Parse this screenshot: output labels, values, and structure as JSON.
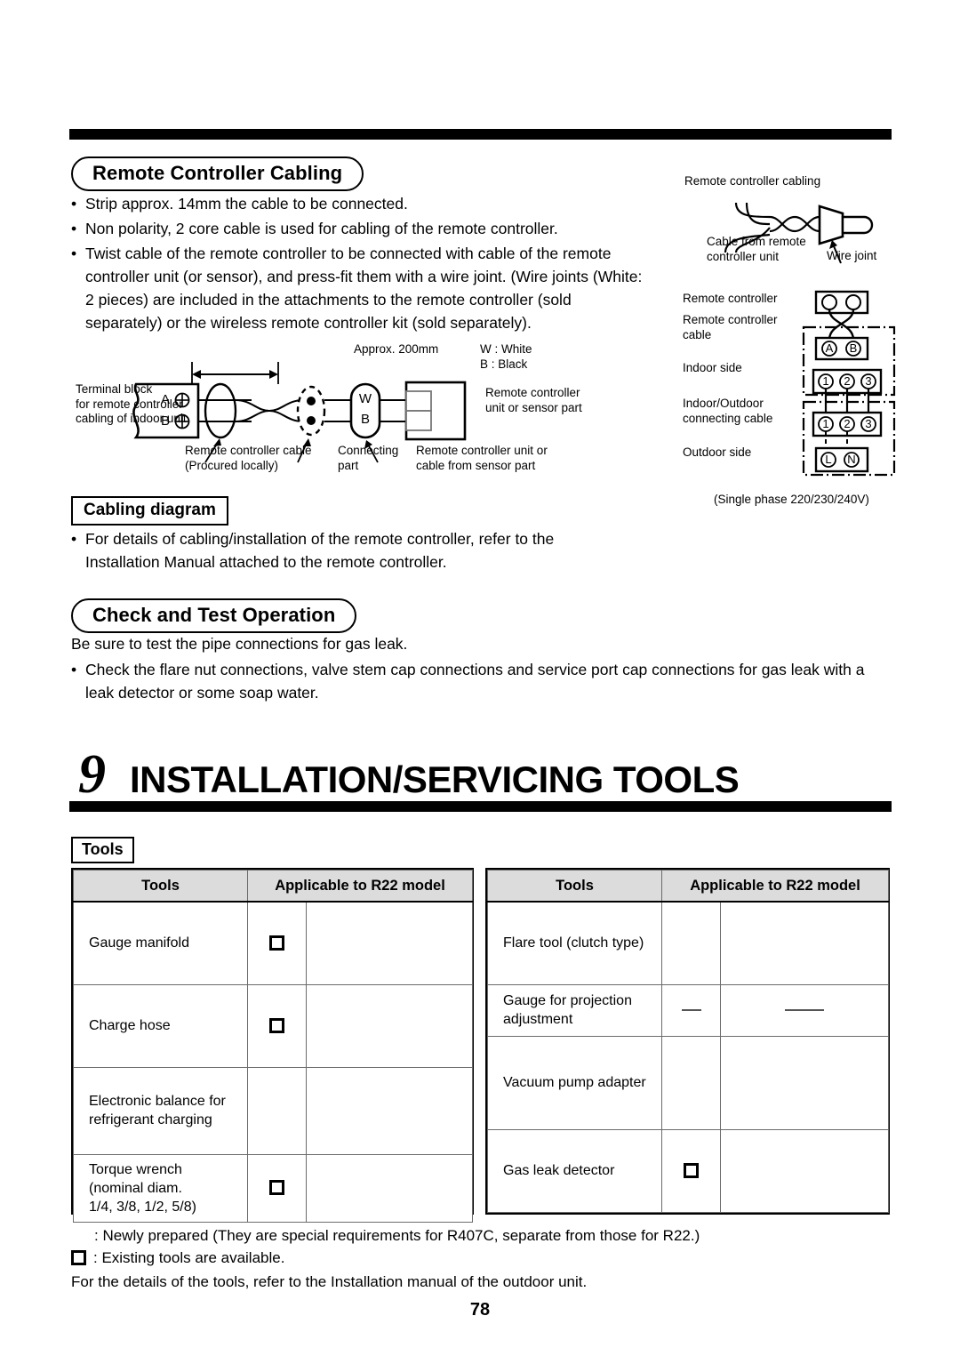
{
  "page": {
    "number": "78"
  },
  "remote_controller_cabling": {
    "heading": "Remote Controller Cabling",
    "bullets": [
      "Strip approx. 14mm the cable to be connected.",
      "Non polarity, 2 core cable is used for cabling of the remote controller.",
      "Twist cable of the remote controller to be connected with cable of the remote controller unit (or sensor), and press-fit them with a wire joint. (Wire joints (White: 2 pieces) are included in the attachments to the remote controller (sold separately) or the wireless remote controller kit (sold separately)."
    ]
  },
  "wire_joint_diagram": {
    "label_top": "Remote controller cabling",
    "label_cable_from": "Cable from remote\ncontroller unit",
    "label_wire_joint": "Wire joint"
  },
  "terminal_diagram": {
    "label_terminal_block": "Terminal block\nfor remote controller\ncabling of indoor unit",
    "terminal_a": "A",
    "terminal_b": "B",
    "label_remote_cable": "Remote controller cable\n(Procured locally)",
    "label_connecting_part": "Connecting\npart",
    "label_unit_cable": "Remote controller unit or\ncable from sensor part",
    "label_approx": "Approx. 200mm",
    "legend_w": "W : White",
    "legend_b": "B : Black",
    "conn_w": "W",
    "conn_b": "B",
    "label_unit_or_sensor": "Remote controller\nunit or sensor part"
  },
  "wiring_diagram": {
    "labels": [
      "Remote controller",
      "Remote controller\ncable",
      "Indoor side",
      "Indoor/Outdoor\nconnecting cable",
      "Outdoor side"
    ],
    "terminals_ab": [
      "A",
      "B"
    ],
    "terminals_indoor": [
      "1",
      "2",
      "3"
    ],
    "terminals_outdoor": [
      "1",
      "2",
      "3"
    ],
    "terminals_power": [
      "L",
      "N"
    ],
    "caption": "(Single phase 220/230/240V)"
  },
  "cabling_diagram": {
    "heading": "Cabling diagram",
    "bullets": [
      "For details of cabling/installation of the remote controller, refer to the Installation Manual attached to the remote controller."
    ]
  },
  "check_and_test": {
    "heading": "Check and Test Operation",
    "intro": "Be sure to test the pipe connections for gas leak.",
    "bullets": [
      "Check the flare nut connections, valve stem cap connections and service port cap connections for gas leak with a leak detector or some soap water."
    ]
  },
  "section": {
    "number": "9",
    "title": "INSTALLATION/SERVICING TOOLS"
  },
  "tools": {
    "heading": "Tools",
    "columns": [
      "Tools",
      "Applicable to R22 model"
    ],
    "left_rows": [
      {
        "name": "Gauge manifold",
        "mark_a": "checkbox",
        "mark_b": ""
      },
      {
        "name": "Charge hose",
        "mark_a": "checkbox",
        "mark_b": ""
      },
      {
        "name": "Electronic balance for\nrefrigerant charging",
        "mark_a": "",
        "mark_b": ""
      },
      {
        "name": "Torque wrench\n(nominal diam.\n1/4, 3/8, 1/2, 5/8)",
        "mark_a": "checkbox",
        "mark_b": ""
      }
    ],
    "right_rows": [
      {
        "name": "Flare tool (clutch type)",
        "mark_a": "",
        "mark_b": ""
      },
      {
        "name": "Gauge for projection\nadjustment",
        "mark_a": "dash",
        "mark_b": "dash"
      },
      {
        "name": "Vacuum pump adapter",
        "mark_a": "",
        "mark_b": ""
      },
      {
        "name": "Gas leak detector",
        "mark_a": "checkbox",
        "mark_b": ""
      }
    ],
    "footnotes": [
      {
        "marker": "blank",
        "text": ": Newly prepared (They are special requirements for R407C, separate from those for R22.)"
      },
      {
        "marker": "checkbox",
        "text": ": Existing tools are available."
      }
    ],
    "footer_note": "For the details of the tools, refer to the Installation manual of the outdoor unit."
  }
}
